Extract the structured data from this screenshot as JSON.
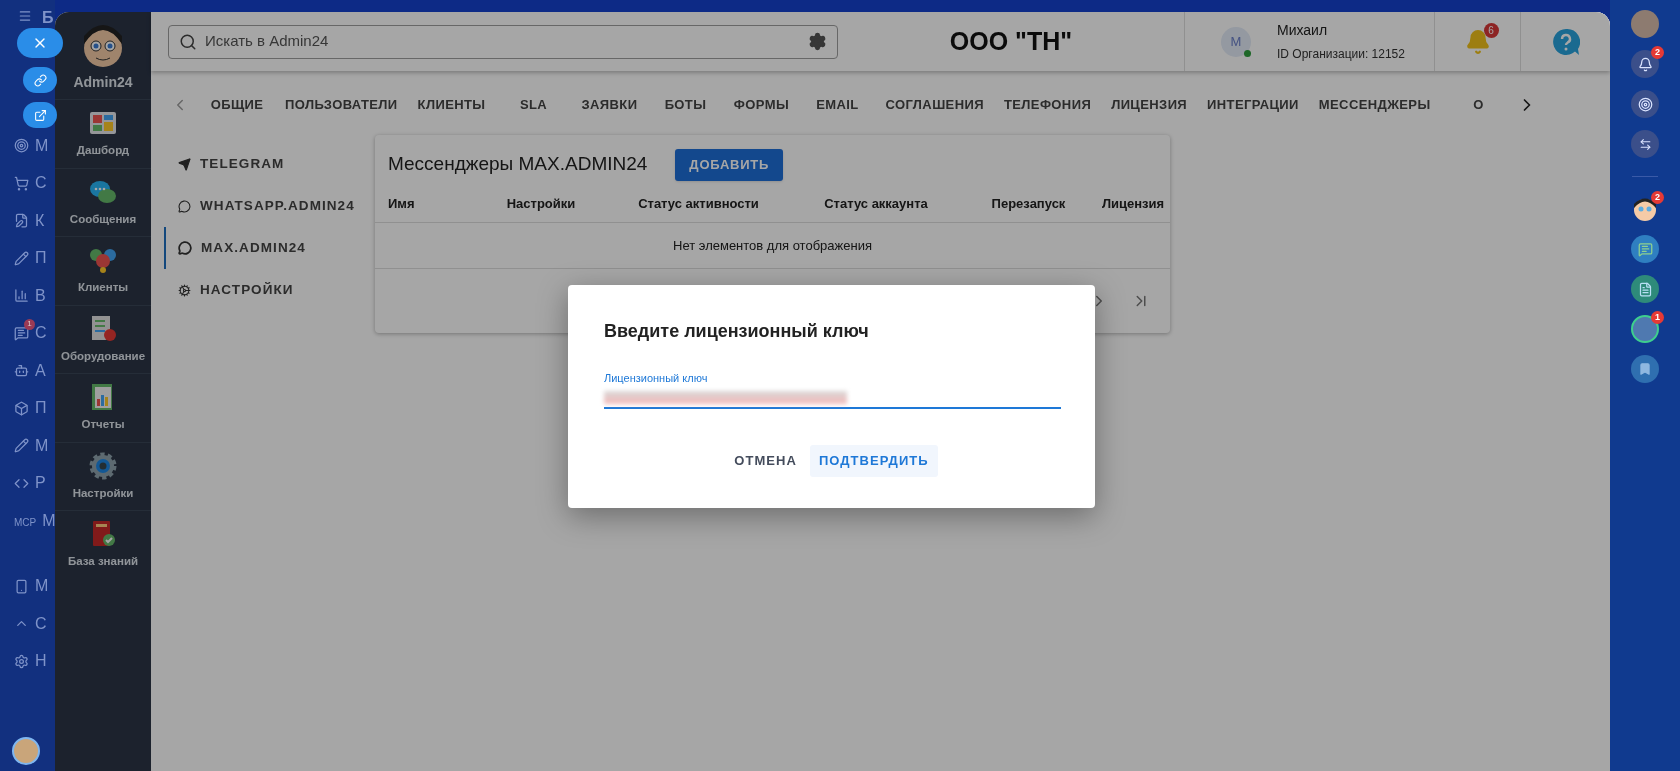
{
  "background_menu": {
    "header": "Б",
    "items": [
      {
        "text": "М"
      },
      {
        "text": "С"
      },
      {
        "text": "К"
      },
      {
        "text": "П"
      },
      {
        "text": "В"
      },
      {
        "text": "С",
        "badge": "1"
      },
      {
        "text": "А"
      },
      {
        "text": "П"
      },
      {
        "text": "М"
      },
      {
        "text": "Р"
      },
      {
        "text": "М",
        "icon_text": "MCP"
      },
      {
        "text": "М"
      },
      {
        "text": "С"
      },
      {
        "text": "Н"
      }
    ]
  },
  "app_nav": {
    "brand": "Admin24",
    "items": [
      {
        "label": "Дашборд"
      },
      {
        "label": "Сообщения"
      },
      {
        "label": "Клиенты"
      },
      {
        "label": "Оборудование"
      },
      {
        "label": "Отчеты"
      },
      {
        "label": "Настройки"
      },
      {
        "label": "База знаний"
      }
    ]
  },
  "header": {
    "search": {
      "placeholder": "Искать в Admin24"
    },
    "company": "ООО \"ТН\"",
    "user": {
      "initial": "М",
      "online": true,
      "name": "Михаил",
      "org_id": "ID Организации: 12152"
    },
    "notifications_badge": "6"
  },
  "tabs": [
    "ОБЩИЕ",
    "ПОЛЬЗОВАТЕЛИ",
    "КЛИЕНТЫ",
    "SLA",
    "ЗАЯВКИ",
    "БОТЫ",
    "ФОРМЫ",
    "EMAIL",
    "СОГЛАШЕНИЯ",
    "ТЕЛЕФОНИЯ",
    "ЛИЦЕНЗИЯ",
    "ИНТЕГРАЦИИ",
    "МЕССЕНДЖЕРЫ",
    "О"
  ],
  "side_menu": [
    {
      "label": "TELEGRAM",
      "selected": false
    },
    {
      "label": "WHATSAPP.ADMIN24",
      "selected": false
    },
    {
      "label": "MAX.ADMIN24",
      "selected": true
    },
    {
      "label": "НАСТРОЙКИ",
      "selected": false
    }
  ],
  "card": {
    "title": "Мессенджеры MAX.ADMIN24",
    "add_button": "ДОБАВИТЬ",
    "columns": [
      "Имя",
      "Настройки",
      "Статус активности",
      "Статус аккаунта",
      "Перезапуск",
      "Лицензия"
    ],
    "empty_message": "Нет элементов для отображения"
  },
  "dialog": {
    "title": "Введите лицензионный ключ",
    "field_label": "Лицензионный ключ",
    "buttons": [
      {
        "label": "ОТМЕНА",
        "kind": "secondary"
      },
      {
        "label": "ПОДТВЕРДИТЬ",
        "kind": "primary"
      }
    ]
  },
  "right_strip": [
    {
      "kind": "photo"
    },
    {
      "kind": "bell",
      "badge": "2"
    },
    {
      "kind": "spiral"
    },
    {
      "kind": "chat"
    },
    {
      "kind": "divider"
    },
    {
      "kind": "face",
      "badge": "2"
    },
    {
      "kind": "message"
    },
    {
      "kind": "document"
    },
    {
      "kind": "photo-ring",
      "badge": "1"
    },
    {
      "kind": "bookmark"
    }
  ]
}
